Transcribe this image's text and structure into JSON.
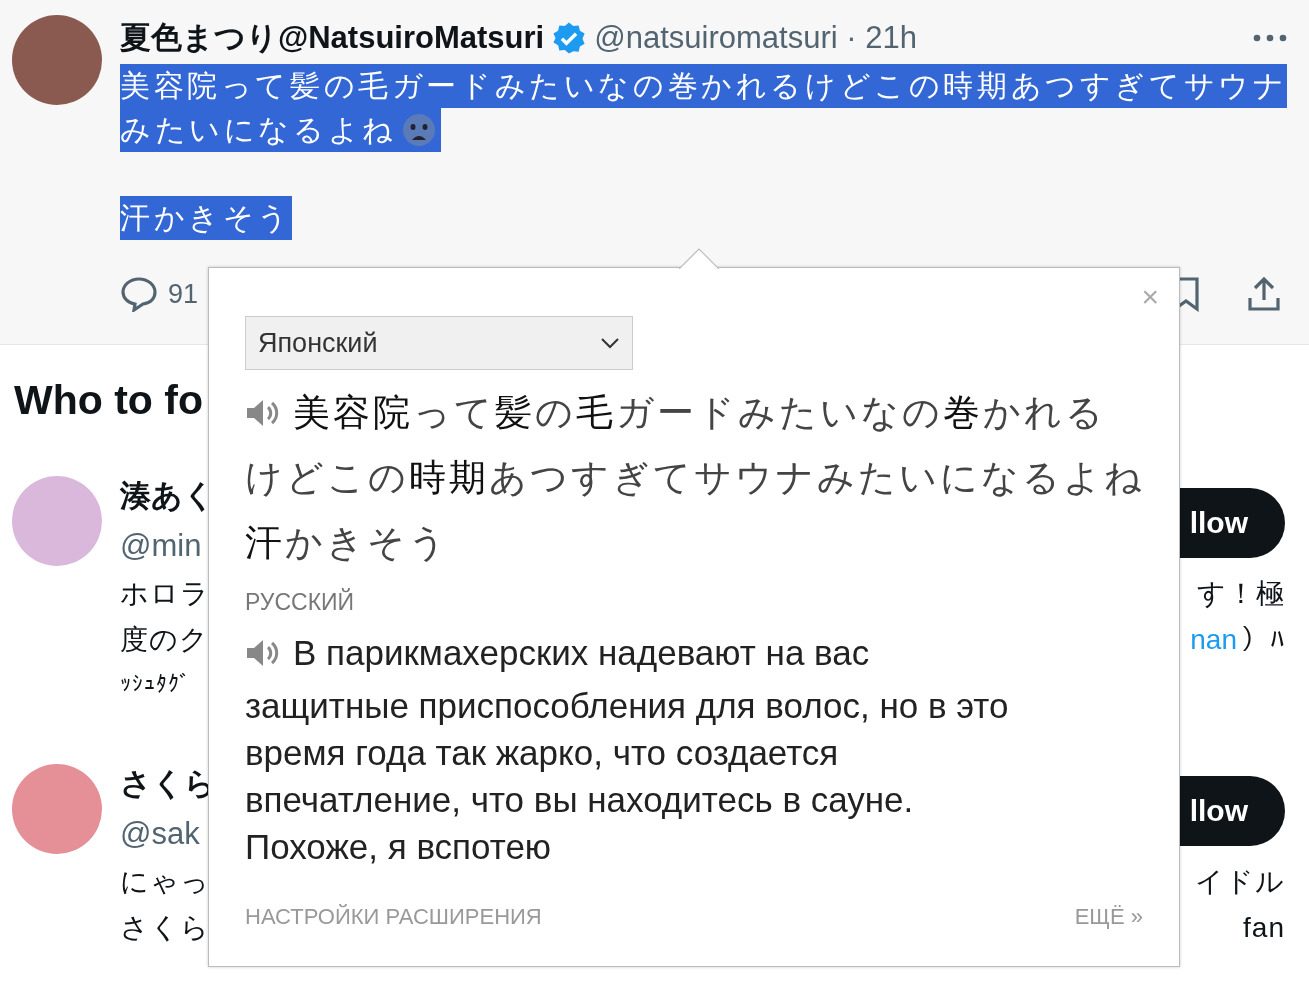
{
  "tweet": {
    "author_name": "夏色まつり@NatsuiroMatsuri",
    "verified": true,
    "handle_time": "@natsuiromatsuri · 21h",
    "text": {
      "selected": true,
      "paragraphs": [
        [
          "美容院って髪の毛ガードみたいなの巻かれるけどこの時期あつすぎてサウナ",
          "みたいになるよね"
        ],
        [
          "汗かきそう"
        ]
      ]
    },
    "reply_count": "91"
  },
  "who_to_follow": {
    "title": "Who to fo",
    "users": [
      {
        "name": "湊あく",
        "handle": "@min",
        "follow_label": "llow",
        "bio_lines": [
          {
            "kind": "split",
            "left": [
              {
                "kind": "text",
                "text": "ホロラ"
              }
            ],
            "right": [
              {
                "kind": "text",
                "text": "す！極"
              }
            ]
          },
          {
            "kind": "split",
            "left": [
              {
                "kind": "text",
                "text": "度のク"
              }
            ],
            "right": [
              {
                "kind": "link",
                "text": "nan"
              },
              {
                "kind": "text",
                "text": "）ﾊ"
              }
            ]
          },
          {
            "kind": "small",
            "left": [
              {
                "kind": "text",
                "text": "ｯｼｭﾀｸﾞ"
              }
            ]
          }
        ]
      },
      {
        "name": "さくら",
        "handle": "@sak",
        "follow_label": "llow",
        "bio_lines": [
          {
            "kind": "split",
            "left": [
              {
                "kind": "text",
                "text": "にゃっ"
              }
            ],
            "right": [
              {
                "kind": "text",
                "text": "イドル"
              }
            ]
          },
          {
            "kind": "split",
            "left": [
              {
                "kind": "text",
                "text": "さくら"
              }
            ],
            "right": [
              {
                "kind": "text",
                "text": "fan"
              }
            ]
          }
        ]
      }
    ]
  },
  "translator": {
    "close": "×",
    "source_language": "Японский",
    "source_lines": [
      "**美容院**って**髪**の**毛**ガードみたいなの**巻**かれる",
      "けどこの**時期**あつすぎてサウナみたいになるよね",
      "**汗**かきそう"
    ],
    "target_language": "РУССКИЙ",
    "target_lines": [
      "В парикмахерских надевают на вас",
      "защитные приспособления для волос, но в это",
      "время года так жарко, что создается",
      "впечатление, что вы находитесь в сауне.",
      "Похоже, я вспотею"
    ],
    "settings_link": "НАСТРОЙКИ РАСШИРЕНИЯ",
    "more_link": "ЕЩЁ »"
  }
}
